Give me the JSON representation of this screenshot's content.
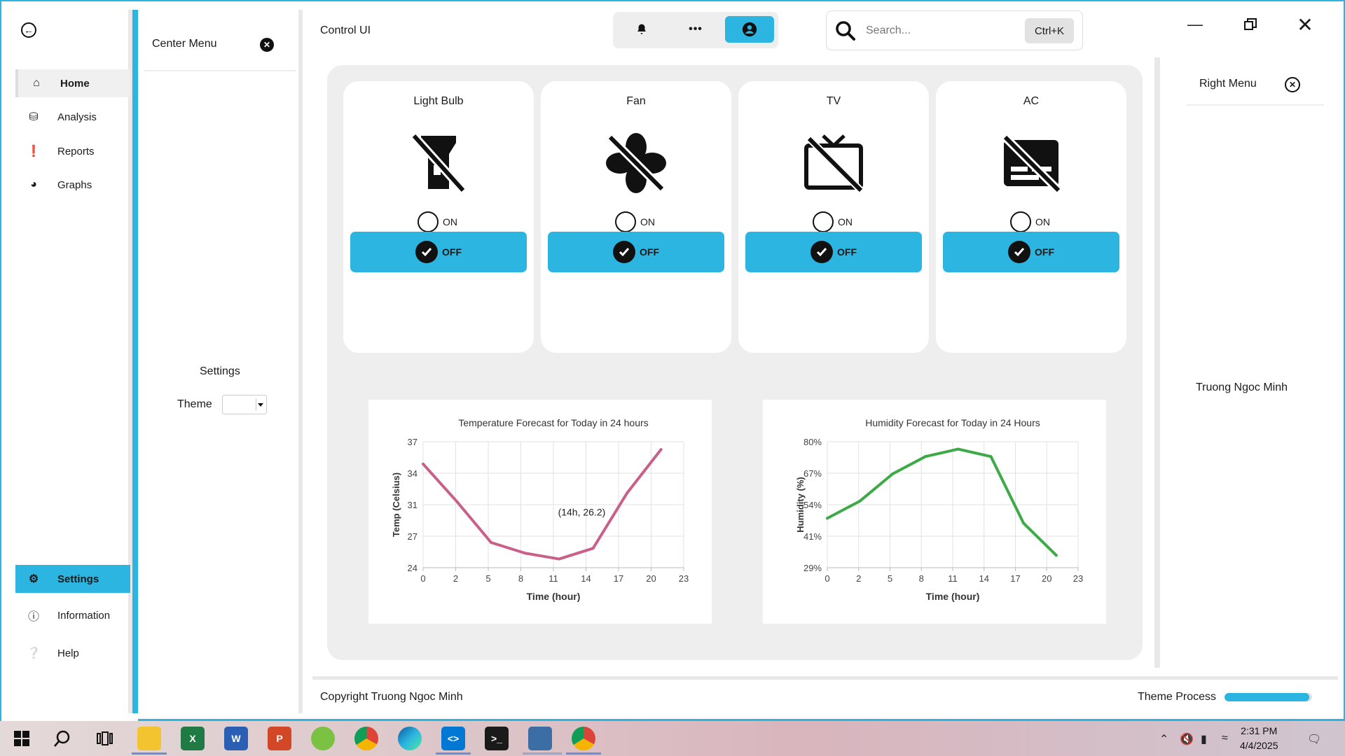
{
  "app": {
    "title": "Control UI"
  },
  "left_nav": {
    "items": [
      {
        "label": "Home",
        "icon": "home-icon"
      },
      {
        "label": "Analysis",
        "icon": "database-icon"
      },
      {
        "label": "Reports",
        "icon": "alert-icon"
      },
      {
        "label": "Graphs",
        "icon": "pie-chart-icon"
      }
    ],
    "bottom_items": [
      {
        "label": "Settings",
        "icon": "gear-icon"
      },
      {
        "label": "Information",
        "icon": "info-icon"
      },
      {
        "label": "Help",
        "icon": "help-icon"
      }
    ]
  },
  "center_menu": {
    "title": "Center Menu",
    "settings_label": "Settings",
    "theme_label": "Theme",
    "theme_value": ""
  },
  "search": {
    "placeholder": "Search...",
    "shortcut": "Ctrl+K"
  },
  "devices": [
    {
      "name": "Light Bulb",
      "icon": "flashlight-off-icon",
      "on_label": "ON",
      "off_label": "OFF"
    },
    {
      "name": "Fan",
      "icon": "fan-off-icon",
      "on_label": "ON",
      "off_label": "OFF"
    },
    {
      "name": "TV",
      "icon": "tv-off-icon",
      "on_label": "ON",
      "off_label": "OFF"
    },
    {
      "name": "AC",
      "icon": "subtitles-off-icon",
      "on_label": "ON",
      "off_label": "OFF"
    }
  ],
  "chart_data": [
    {
      "type": "line",
      "title": "Temperature Forecast for Today in 24 hours",
      "xlabel": "Time (hour)",
      "ylabel": "Temp (Celsius)",
      "x_ticks": [
        "0",
        "2",
        "5",
        "8",
        "11",
        "14",
        "17",
        "20",
        "23"
      ],
      "y_ticks": [
        "24",
        "27",
        "31",
        "34",
        "37"
      ],
      "xlim": [
        0,
        23
      ],
      "ylim": [
        24,
        37
      ],
      "x": [
        0,
        3,
        6,
        9,
        12,
        15,
        18,
        21
      ],
      "series": [
        {
          "values": [
            34.7,
            30.8,
            26.6,
            25.5,
            24.9,
            26.0,
            31.7,
            36.2
          ],
          "color": "#c9608a"
        }
      ],
      "annotation": {
        "text": "(14h, 26.2)",
        "x": 14,
        "y": 26.2
      },
      "grid": true
    },
    {
      "type": "line",
      "title": "Humidity Forecast for Today in 24 Hours",
      "xlabel": "Time (hour)",
      "ylabel": "Humidity (%)",
      "x_ticks": [
        "0",
        "2",
        "5",
        "8",
        "11",
        "14",
        "17",
        "20",
        "23"
      ],
      "y_ticks": [
        "29%",
        "41%",
        "54%",
        "67%",
        "80%"
      ],
      "xlim": [
        0,
        23
      ],
      "ylim": [
        29,
        80
      ],
      "x": [
        0,
        3,
        6,
        9,
        12,
        15,
        18,
        21
      ],
      "series": [
        {
          "values": [
            49,
            56,
            67,
            74,
            77,
            74,
            47,
            34
          ],
          "color": "#3daa47"
        }
      ],
      "grid": true
    }
  ],
  "right_menu": {
    "title": "Right Menu",
    "user_name": "Truong Ngoc Minh"
  },
  "footer": {
    "copyright": "Copyright Truong Ngoc Minh",
    "theme_process_label": "Theme Process",
    "theme_process_value": 0.97
  },
  "taskbar": {
    "time": "2:31 PM",
    "date": "4/4/2025"
  },
  "colors": {
    "accent": "#2bb5e0",
    "temp_line": "#c9608a",
    "humidity_line": "#3daa47"
  }
}
